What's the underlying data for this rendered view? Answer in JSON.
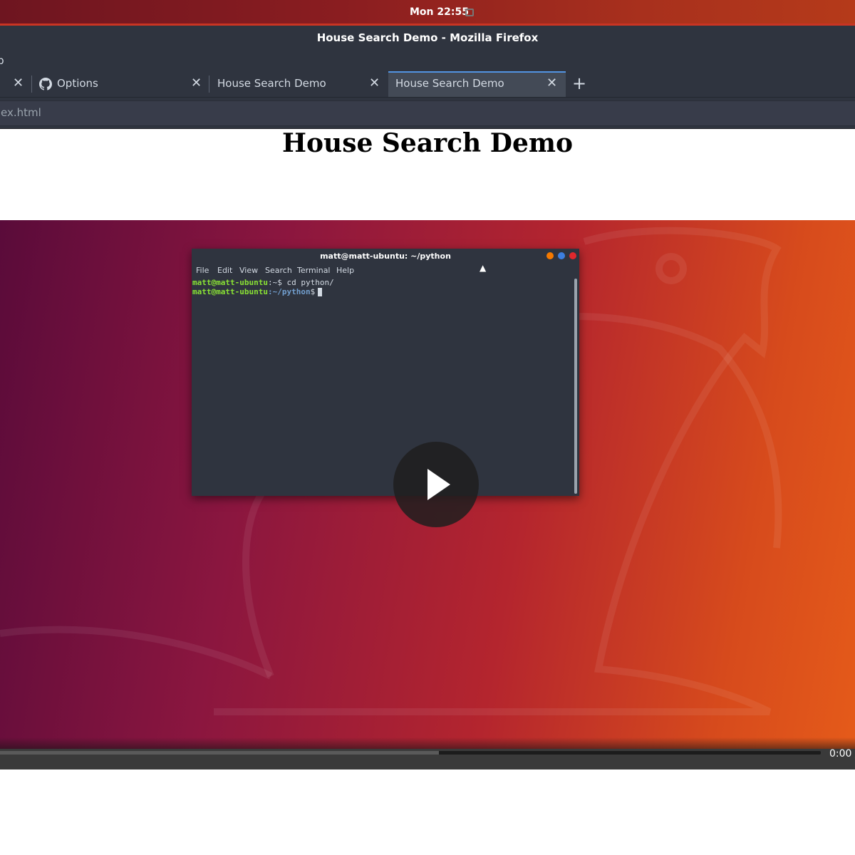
{
  "system": {
    "clock": "Mon 22:55"
  },
  "window": {
    "title": "House Search Demo - Mozilla Firefox"
  },
  "menubar": {
    "help_partial": "lp"
  },
  "tabs": [
    {
      "label": "",
      "active": false
    },
    {
      "label": "Options",
      "active": false,
      "icon": "github-icon"
    },
    {
      "label": "House Search Demo",
      "active": false
    },
    {
      "label": "House Search Demo",
      "active": true
    }
  ],
  "navbar": {
    "url": "ex.html"
  },
  "page": {
    "title": "House Search Demo"
  },
  "video": {
    "terminal": {
      "title": "matt@matt-ubuntu: ~/python",
      "menu": [
        "File",
        "Edit",
        "View",
        "Search",
        "Terminal",
        "Help"
      ],
      "line1": {
        "user": "matt@matt-ubuntu",
        "path": ":~$",
        "cmd": " cd python/"
      },
      "line2": {
        "user": "matt@matt-ubuntu",
        "path": ":~/python",
        "prompt": "$"
      }
    },
    "time": "0:00 /",
    "buffered_fraction": 0.535
  },
  "colors": {
    "accent": "#5294e2",
    "topbar": "#8a1d20",
    "window": "#2f343f"
  }
}
